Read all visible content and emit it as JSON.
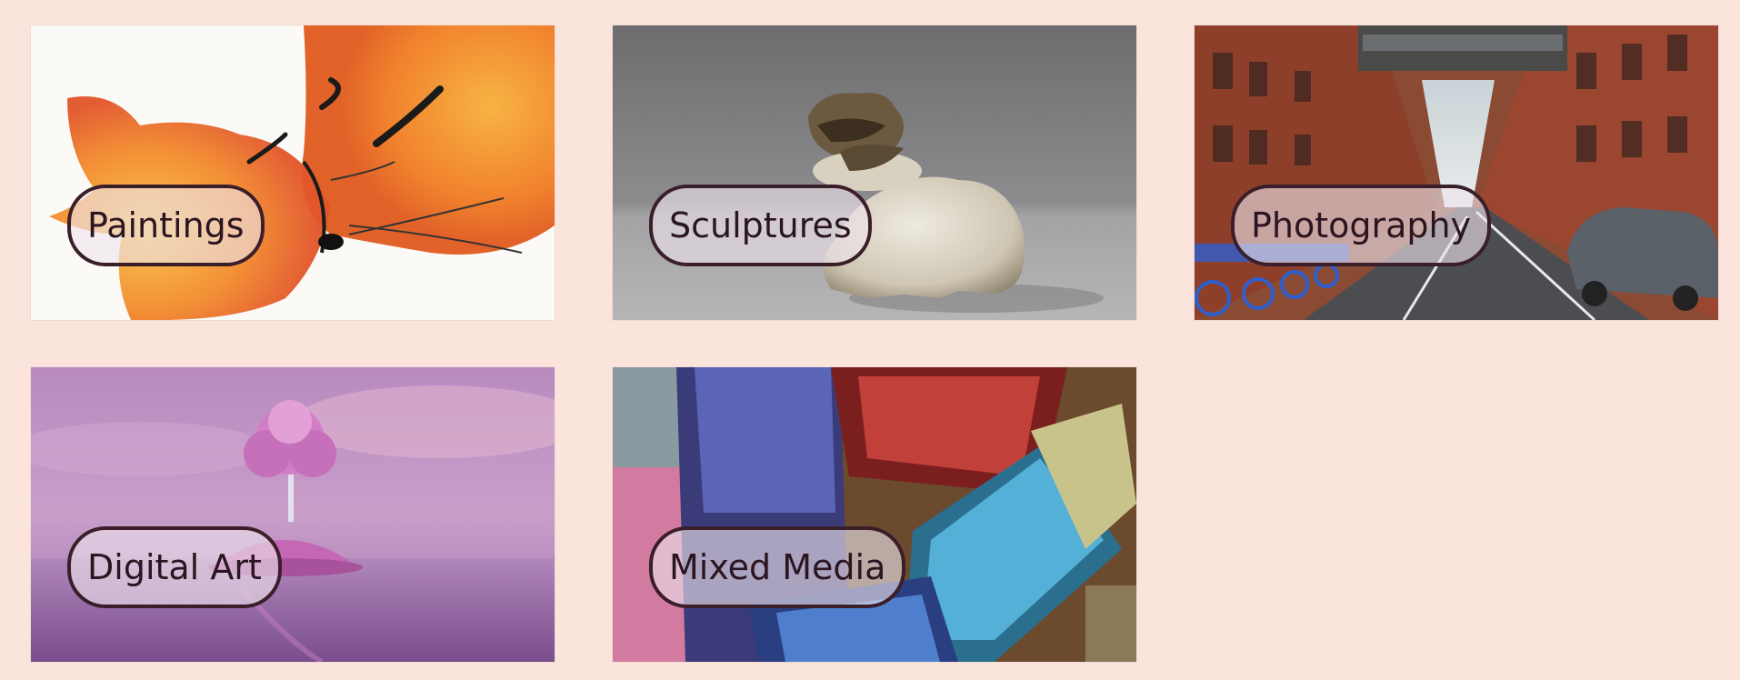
{
  "categories": [
    {
      "id": "paintings",
      "label": "Paintings",
      "image_desc": "watercolor-foxes"
    },
    {
      "id": "sculptures",
      "label": "Sculptures",
      "image_desc": "ceramic-dragon-figurine"
    },
    {
      "id": "photography",
      "label": "Photography",
      "image_desc": "city-street-with-bridge"
    },
    {
      "id": "digital-art",
      "label": "Digital Art",
      "image_desc": "pink-tree-on-island"
    },
    {
      "id": "mixed-media",
      "label": "Mixed Media",
      "image_desc": "paint-brushes"
    }
  ],
  "theme": {
    "background": "#fae4db",
    "label_border": "#3a1f2a",
    "label_text": "#2b1521"
  }
}
